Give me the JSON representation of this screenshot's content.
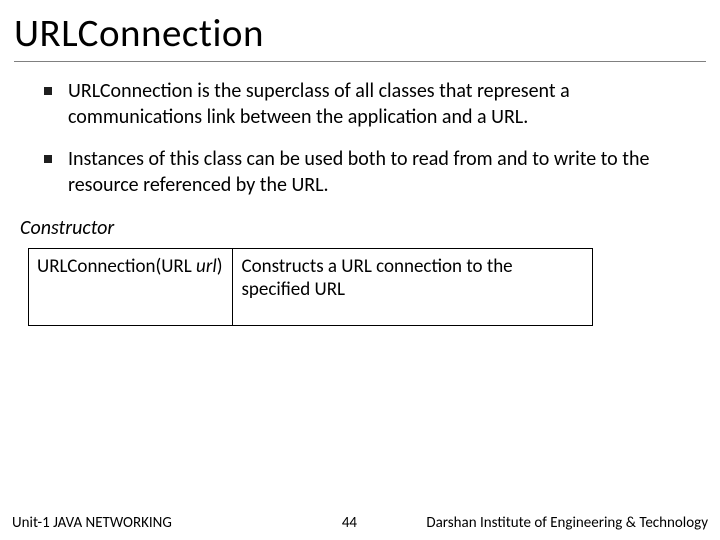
{
  "title": "URLConnection",
  "bullets": [
    "URLConnection is the superclass of all classes that represent a communications link between the application and a URL.",
    "Instances of this class can be used both to read from and to write to the resource referenced by the URL."
  ],
  "section_label": "Constructor",
  "constructor_table": {
    "signature_prefix": "URLConnection(URL ",
    "signature_param": "url",
    "signature_suffix": ")",
    "description": "Constructs a URL connection to the specified URL"
  },
  "footer": {
    "unit": "Unit-1 JAVA NETWORKING",
    "page": "44",
    "institute": "Darshan Institute of Engineering & Technology"
  }
}
